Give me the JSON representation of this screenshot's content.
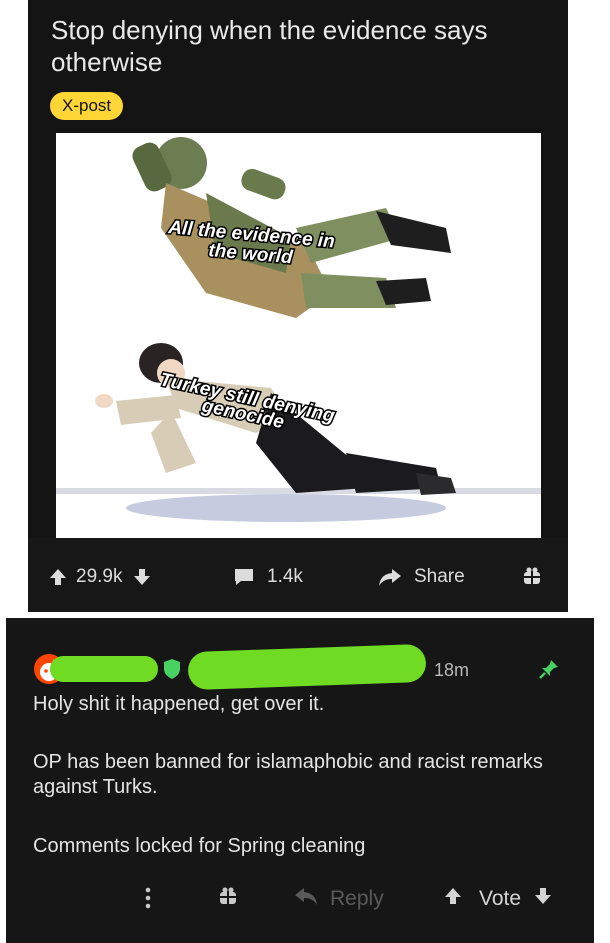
{
  "post": {
    "title": "Stop denying when the evidence says otherwise",
    "flair": "X-post",
    "image": {
      "upper_caption_line1": "All the evidence in",
      "upper_caption_line2": "the world",
      "lower_caption_line1": "Turkey still denying",
      "lower_caption_line2": "genocide"
    },
    "actions": {
      "upvotes": "29.9k",
      "comments": "1.4k",
      "share": "Share"
    }
  },
  "comment": {
    "time": "18m",
    "body_line1": "Holy shit it happened, get over it.",
    "body_line2": "OP has been banned for islamaphobic and racist remarks against Turks.",
    "body_line3": "Comments locked for Spring cleaning",
    "actions": {
      "reply": "Reply",
      "vote": "Vote"
    }
  },
  "colors": {
    "post_bg": "#141414",
    "comment_bg": "#161616",
    "flair_bg": "#ffd635",
    "mod_green": "#46d160",
    "redaction_green": "#6fdb23"
  },
  "icons": [
    "upvote-icon",
    "downvote-icon",
    "comment-icon",
    "share-icon",
    "award-icon",
    "more-icon",
    "reply-icon",
    "pin-icon",
    "shield-icon",
    "avatar-icon"
  ]
}
